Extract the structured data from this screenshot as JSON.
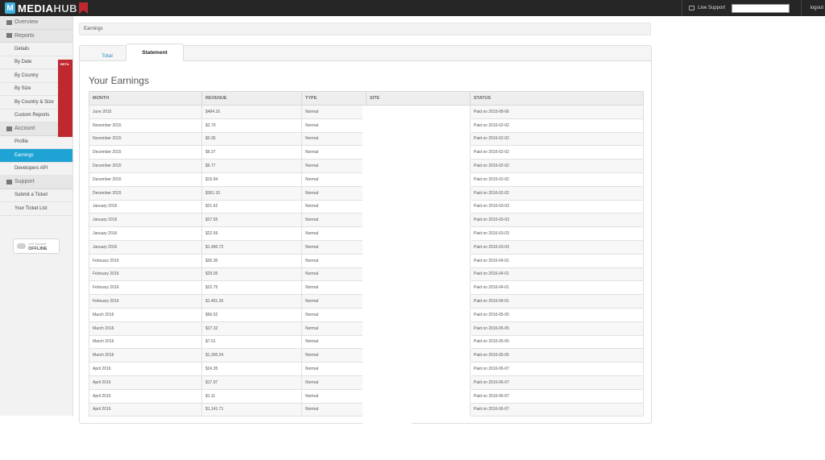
{
  "topbar": {
    "logo_letter": "M",
    "logo_media": "MEDIA",
    "logo_hub": "HUB",
    "live_support": "Live Support",
    "search_value": "",
    "logout": "logout"
  },
  "sidebar": {
    "overview": "Overview",
    "reports": "Reports",
    "reports_items": [
      "Details",
      "By Date",
      "By Country",
      "By Size",
      "By Country & Size",
      "Custom Reports"
    ],
    "beta": "BETA",
    "account": "Account",
    "account_items": [
      "Profile",
      "Earnings",
      "Developers API"
    ],
    "support": "Support",
    "support_items": [
      "Submit a Ticket",
      "Your Ticket List"
    ],
    "live_support_small": "Live Support",
    "offline": "OFFLINE"
  },
  "breadcrumb": "Earnings",
  "tabs": {
    "total": "Total",
    "statement": "Statement"
  },
  "heading": "Your Earnings",
  "table": {
    "headers": [
      "MONTH",
      "REVENUE",
      "TYPE",
      "SITE",
      "STATUS"
    ],
    "rows": [
      [
        "June 2015",
        "$484.16",
        "Normal",
        "",
        "Paid on 2015-08-06"
      ],
      [
        "November 2015",
        "$2.79",
        "Normal",
        "",
        "Paid on 2016-02-02"
      ],
      [
        "November 2015",
        "$0.35",
        "Normal",
        "",
        "Paid on 2016-02-02"
      ],
      [
        "December 2015",
        "$6.27",
        "Normal",
        "",
        "Paid on 2016-02-02"
      ],
      [
        "December 2015",
        "$6.77",
        "Normal",
        "",
        "Paid on 2016-02-02"
      ],
      [
        "December 2015",
        "$15.94",
        "Normal",
        "",
        "Paid on 2016-02-02"
      ],
      [
        "December 2015",
        "$361.10",
        "Normal",
        "",
        "Paid on 2016-02-02"
      ],
      [
        "January 2016",
        "$21.62",
        "Normal",
        "",
        "Paid on 2016-03-03"
      ],
      [
        "January 2016",
        "$27.55",
        "Normal",
        "",
        "Paid on 2016-03-03"
      ],
      [
        "January 2016",
        "$22.59",
        "Normal",
        "",
        "Paid on 2016-03-03"
      ],
      [
        "January 2016",
        "$1,490.72",
        "Normal",
        "",
        "Paid on 2016-03-03"
      ],
      [
        "February 2016",
        "$30.30",
        "Normal",
        "",
        "Paid on 2016-04-01"
      ],
      [
        "February 2016",
        "$29.05",
        "Normal",
        "",
        "Paid on 2016-04-01"
      ],
      [
        "February 2016",
        "$22.75",
        "Normal",
        "",
        "Paid on 2016-04-01"
      ],
      [
        "February 2016",
        "$1,401.26",
        "Normal",
        "",
        "Paid on 2016-04-01"
      ],
      [
        "March 2016",
        "$66.52",
        "Normal",
        "",
        "Paid on 2016-05-05"
      ],
      [
        "March 2016",
        "$27.32",
        "Normal",
        "",
        "Paid on 2016-05-05"
      ],
      [
        "March 2016",
        "$7.01",
        "Normal",
        "",
        "Paid on 2016-05-05"
      ],
      [
        "March 2016",
        "$1,300.24",
        "Normal",
        "",
        "Paid on 2016-05-05"
      ],
      [
        "April 2016",
        "$24.35",
        "Normal",
        "",
        "Paid on 2016-06-07"
      ],
      [
        "April 2016",
        "$17.97",
        "Normal",
        "",
        "Paid on 2016-06-07"
      ],
      [
        "April 2016",
        "$1.11",
        "Normal",
        "",
        "Paid on 2016-06-07"
      ],
      [
        "April 2016",
        "$1,141.71",
        "Normal",
        "",
        "Paid on 2016-06-07"
      ]
    ]
  },
  "colors": {
    "topbar": "#262626",
    "accent": "#1fa3d4",
    "beta": "#c0282f"
  }
}
